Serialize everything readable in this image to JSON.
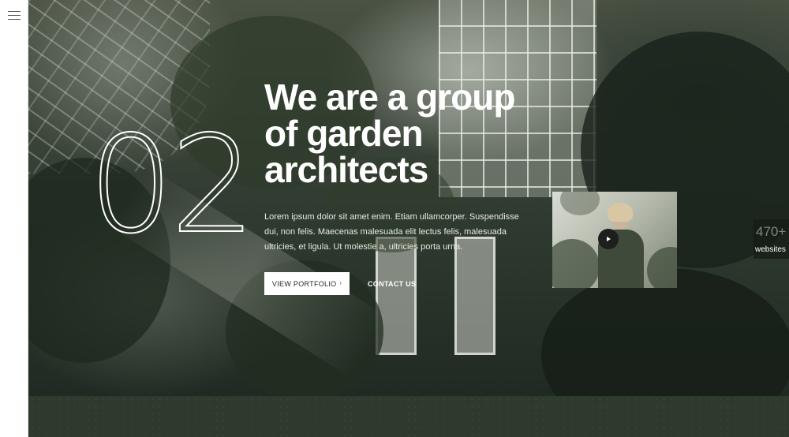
{
  "sidebar": {
    "menu_icon": "hamburger-menu-icon"
  },
  "hero": {
    "slide_number": "02",
    "headline_lines": [
      "We are a group",
      "of garden",
      "architects"
    ],
    "intro": "Lorem ipsum dolor sit amet enim. Etiam ullamcorper. Suspendisse dui, non felis. Maecenas malesuada elit lectus felis, malesuada ultricies, et ligula. Ut molestie a, ultricies porta urna.",
    "primary_button": {
      "label": "VIEW PORTFOLIO",
      "icon": "chevron-right-icon",
      "arrow": "›"
    },
    "secondary_button": {
      "label": "CONTACT US"
    },
    "video": {
      "icon": "play-icon"
    }
  },
  "stats_badge": {
    "number": "470+",
    "label": "websites"
  },
  "colors": {
    "dark_green": "#2f3a2e",
    "text_light": "#ffffff",
    "button_bg": "#ffffff"
  }
}
